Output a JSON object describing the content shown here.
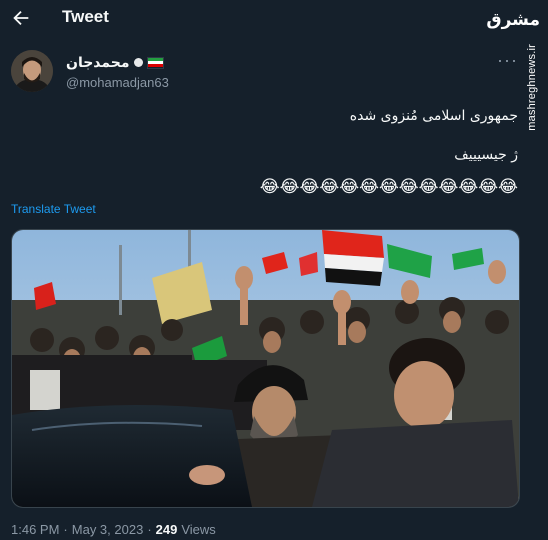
{
  "header": {
    "title": "Tweet"
  },
  "watermark": {
    "logo": "مشرق",
    "site": "mashreghnews.ir"
  },
  "author": {
    "name": "محمدجان",
    "handle": "@mohamadjan63"
  },
  "tweet": {
    "line1": "جمهوری اسلامی مُنزوی شده",
    "line2": "ژ جیسیییف",
    "emojis": "😂😂😂😂😂😂😂😂😂😂😂😂😂"
  },
  "translate_label": "Translate Tweet",
  "footer": {
    "time": "1:46 PM",
    "sep1": "·",
    "date": "May 3, 2023",
    "sep2": "·",
    "views_count": "249",
    "views_label": "Views"
  },
  "colors": {
    "background": "#15202b",
    "link": "#1d9bf0",
    "secondary_text": "#8b98a5"
  },
  "icons": [
    "back-arrow-icon",
    "verified-icon",
    "iran-flag-icon",
    "more-icon"
  ]
}
